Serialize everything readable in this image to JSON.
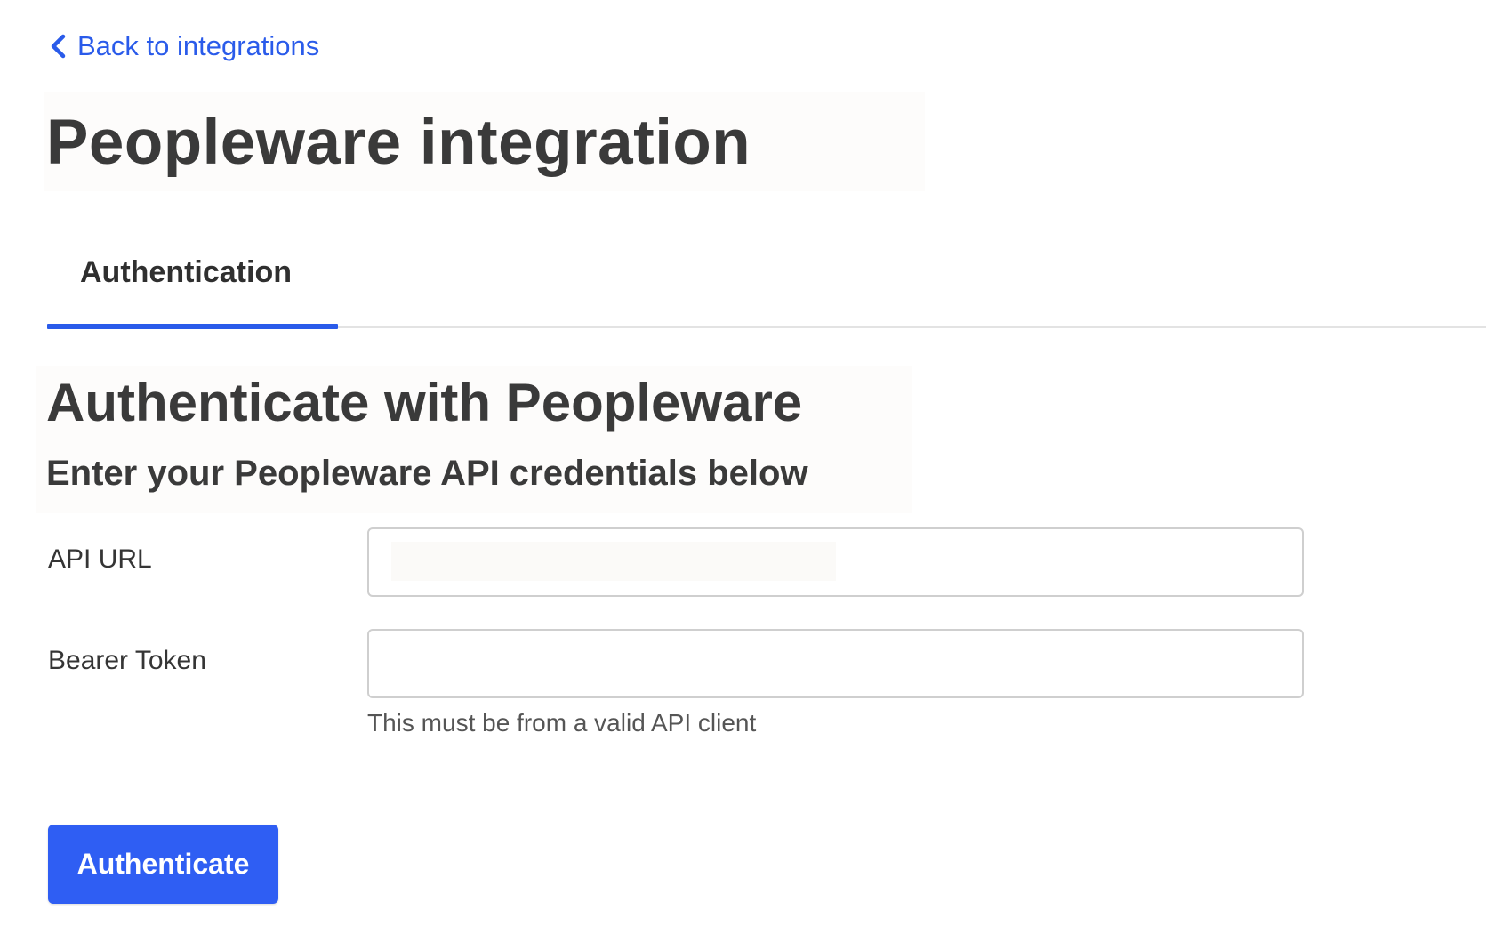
{
  "nav": {
    "back_label": "Back to integrations"
  },
  "page": {
    "title": "Peopleware integration"
  },
  "tabs": [
    {
      "label": "Authentication",
      "active": true
    }
  ],
  "section": {
    "title": "Authenticate with Peopleware",
    "subtitle": "Enter your Peopleware API credentials below"
  },
  "form": {
    "api_url": {
      "label": "API URL",
      "value": ""
    },
    "bearer_token": {
      "label": "Bearer Token",
      "value": "",
      "help": "This must be from a valid API client"
    },
    "submit_label": "Authenticate"
  },
  "colors": {
    "accent": "#2a5bea",
    "button": "#2f5ef3",
    "text": "#3a3a3a"
  },
  "icons": {
    "back": "chevron-left-icon"
  }
}
